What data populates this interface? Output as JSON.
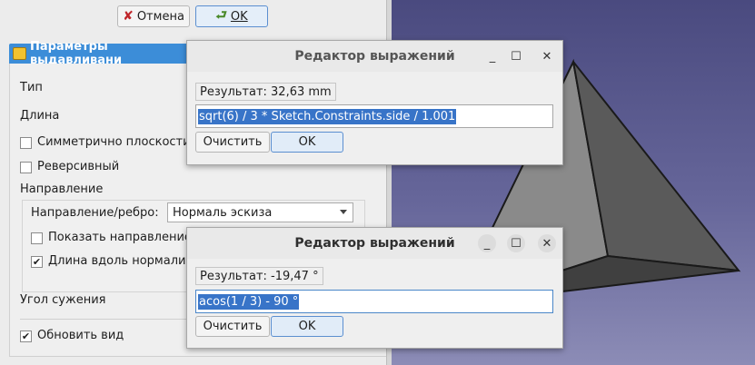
{
  "toolbar": {
    "cancel_label": "Отмена",
    "ok_label": "OK"
  },
  "panel": {
    "title": "Параметры выдавливани",
    "type_label": "Тип",
    "length_label": "Длина",
    "symmetric_label": "Симметрично плоскости",
    "symmetric_checked": false,
    "reversed_label": "Реверсивный",
    "reversed_checked": false,
    "direction_group_label": "Направление",
    "direction_edge_label": "Направление/ребро:",
    "direction_value": "Нормаль эскиза",
    "show_direction_label": "Показать направление",
    "show_direction_checked": false,
    "along_normal_label": "Длина вдоль нормали эс",
    "along_normal_checked": true,
    "taper_label": "Угол сужения",
    "update_view_label": "Обновить вид",
    "update_view_checked": true
  },
  "dialog1": {
    "title": "Редактор выражений",
    "result": "Результат: 32,63 mm",
    "expression": "sqrt(6) / 3 * Sketch.Constraints.side / 1.001",
    "clear_label": "Очистить",
    "ok_label": "OK"
  },
  "dialog2": {
    "title": "Редактор выражений",
    "result": "Результат: -19,47 °",
    "expression": "acos(1 / 3) - 90 °",
    "clear_label": "Очистить",
    "ok_label": "OK"
  },
  "colors": {
    "accent": "#3c8dd8",
    "selection": "#3874c8",
    "view_top": "#4a4a7f",
    "view_bottom": "#8c8cb6"
  }
}
